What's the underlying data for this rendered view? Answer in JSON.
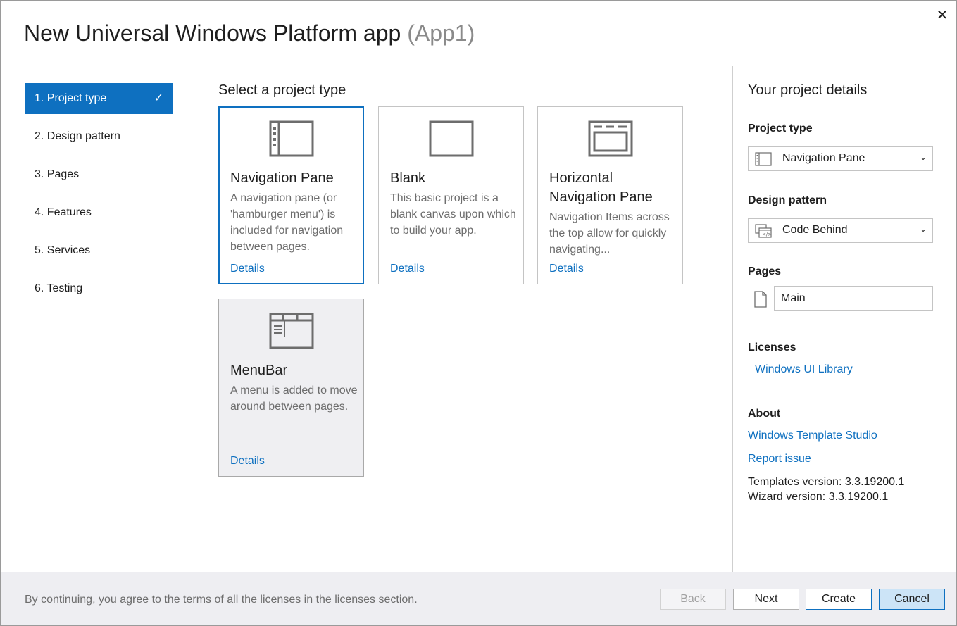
{
  "window": {
    "title": "New Universal Windows Platform app",
    "title_sub": "(App1)",
    "close_glyph": "✕"
  },
  "steps": [
    {
      "label": "1. Project type",
      "active": true,
      "check": "✓"
    },
    {
      "label": "2. Design pattern"
    },
    {
      "label": "3. Pages"
    },
    {
      "label": "4. Features"
    },
    {
      "label": "5. Services"
    },
    {
      "label": "6. Testing"
    }
  ],
  "center": {
    "heading": "Select a project type",
    "cards": [
      {
        "icon": "navigation-pane-icon",
        "title": "Navigation Pane",
        "description": "A navigation pane (or 'hamburger menu') is included for navigation between pages.",
        "link": "Details",
        "state": "selected"
      },
      {
        "icon": "blank-icon",
        "title": "Blank",
        "description": "This basic project is a blank canvas upon which to build your app.",
        "link": "Details"
      },
      {
        "icon": "horizontal-navigation-pane-icon",
        "title": "Horizontal Navigation Pane",
        "description": "Navigation Items across the top allow for quickly navigating...",
        "link": "Details"
      },
      {
        "icon": "menubar-icon",
        "title": "MenuBar",
        "description": "A menu is added to move around between pages.",
        "link": "Details",
        "state": "hover"
      }
    ]
  },
  "details": {
    "heading": "Your project details",
    "project_type_label": "Project type",
    "project_type_value": "Navigation Pane",
    "design_pattern_label": "Design pattern",
    "design_pattern_value": "Code Behind",
    "pages_label": "Pages",
    "page_name": "Main",
    "licenses_label": "Licenses",
    "license_link": "Windows UI Library",
    "about_label": "About",
    "about_link": "Windows Template Studio",
    "report_link": "Report issue",
    "templates_version": "Templates version: 3.3.19200.1",
    "wizard_version": "Wizard version: 3.3.19200.1",
    "chevron": "⌄"
  },
  "footer": {
    "notice": "By continuing, you agree to the terms of all the licenses in the licenses section.",
    "back": "Back",
    "next": "Next",
    "create": "Create",
    "cancel": "Cancel"
  },
  "colors": {
    "accent": "#0e70c0",
    "footer_bg": "#eeeef2",
    "icon_gray": "#6d6d6d"
  }
}
